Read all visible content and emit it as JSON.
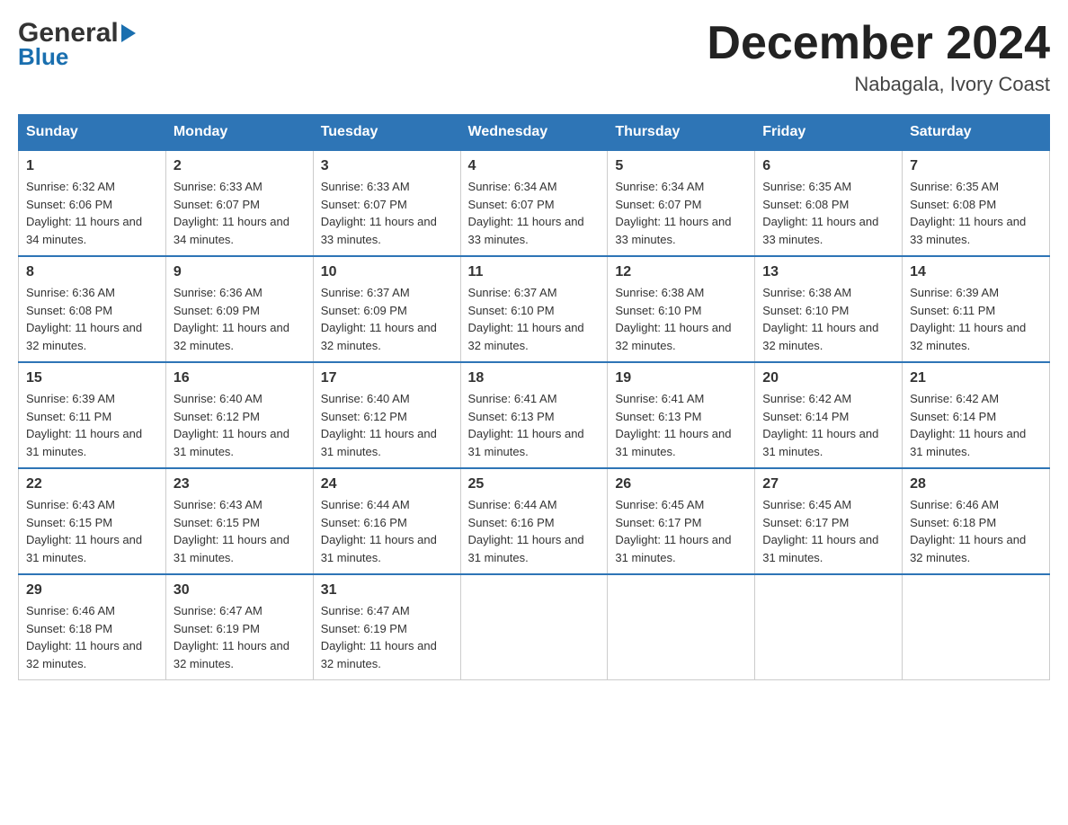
{
  "header": {
    "logo_general": "General",
    "logo_blue": "Blue",
    "month": "December 2024",
    "location": "Nabagala, Ivory Coast"
  },
  "days_of_week": [
    "Sunday",
    "Monday",
    "Tuesday",
    "Wednesday",
    "Thursday",
    "Friday",
    "Saturday"
  ],
  "weeks": [
    [
      {
        "num": "1",
        "sunrise": "6:32 AM",
        "sunset": "6:06 PM",
        "daylight": "11 hours and 34 minutes."
      },
      {
        "num": "2",
        "sunrise": "6:33 AM",
        "sunset": "6:07 PM",
        "daylight": "11 hours and 34 minutes."
      },
      {
        "num": "3",
        "sunrise": "6:33 AM",
        "sunset": "6:07 PM",
        "daylight": "11 hours and 33 minutes."
      },
      {
        "num": "4",
        "sunrise": "6:34 AM",
        "sunset": "6:07 PM",
        "daylight": "11 hours and 33 minutes."
      },
      {
        "num": "5",
        "sunrise": "6:34 AM",
        "sunset": "6:07 PM",
        "daylight": "11 hours and 33 minutes."
      },
      {
        "num": "6",
        "sunrise": "6:35 AM",
        "sunset": "6:08 PM",
        "daylight": "11 hours and 33 minutes."
      },
      {
        "num": "7",
        "sunrise": "6:35 AM",
        "sunset": "6:08 PM",
        "daylight": "11 hours and 33 minutes."
      }
    ],
    [
      {
        "num": "8",
        "sunrise": "6:36 AM",
        "sunset": "6:08 PM",
        "daylight": "11 hours and 32 minutes."
      },
      {
        "num": "9",
        "sunrise": "6:36 AM",
        "sunset": "6:09 PM",
        "daylight": "11 hours and 32 minutes."
      },
      {
        "num": "10",
        "sunrise": "6:37 AM",
        "sunset": "6:09 PM",
        "daylight": "11 hours and 32 minutes."
      },
      {
        "num": "11",
        "sunrise": "6:37 AM",
        "sunset": "6:10 PM",
        "daylight": "11 hours and 32 minutes."
      },
      {
        "num": "12",
        "sunrise": "6:38 AM",
        "sunset": "6:10 PM",
        "daylight": "11 hours and 32 minutes."
      },
      {
        "num": "13",
        "sunrise": "6:38 AM",
        "sunset": "6:10 PM",
        "daylight": "11 hours and 32 minutes."
      },
      {
        "num": "14",
        "sunrise": "6:39 AM",
        "sunset": "6:11 PM",
        "daylight": "11 hours and 32 minutes."
      }
    ],
    [
      {
        "num": "15",
        "sunrise": "6:39 AM",
        "sunset": "6:11 PM",
        "daylight": "11 hours and 31 minutes."
      },
      {
        "num": "16",
        "sunrise": "6:40 AM",
        "sunset": "6:12 PM",
        "daylight": "11 hours and 31 minutes."
      },
      {
        "num": "17",
        "sunrise": "6:40 AM",
        "sunset": "6:12 PM",
        "daylight": "11 hours and 31 minutes."
      },
      {
        "num": "18",
        "sunrise": "6:41 AM",
        "sunset": "6:13 PM",
        "daylight": "11 hours and 31 minutes."
      },
      {
        "num": "19",
        "sunrise": "6:41 AM",
        "sunset": "6:13 PM",
        "daylight": "11 hours and 31 minutes."
      },
      {
        "num": "20",
        "sunrise": "6:42 AM",
        "sunset": "6:14 PM",
        "daylight": "11 hours and 31 minutes."
      },
      {
        "num": "21",
        "sunrise": "6:42 AM",
        "sunset": "6:14 PM",
        "daylight": "11 hours and 31 minutes."
      }
    ],
    [
      {
        "num": "22",
        "sunrise": "6:43 AM",
        "sunset": "6:15 PM",
        "daylight": "11 hours and 31 minutes."
      },
      {
        "num": "23",
        "sunrise": "6:43 AM",
        "sunset": "6:15 PM",
        "daylight": "11 hours and 31 minutes."
      },
      {
        "num": "24",
        "sunrise": "6:44 AM",
        "sunset": "6:16 PM",
        "daylight": "11 hours and 31 minutes."
      },
      {
        "num": "25",
        "sunrise": "6:44 AM",
        "sunset": "6:16 PM",
        "daylight": "11 hours and 31 minutes."
      },
      {
        "num": "26",
        "sunrise": "6:45 AM",
        "sunset": "6:17 PM",
        "daylight": "11 hours and 31 minutes."
      },
      {
        "num": "27",
        "sunrise": "6:45 AM",
        "sunset": "6:17 PM",
        "daylight": "11 hours and 31 minutes."
      },
      {
        "num": "28",
        "sunrise": "6:46 AM",
        "sunset": "6:18 PM",
        "daylight": "11 hours and 32 minutes."
      }
    ],
    [
      {
        "num": "29",
        "sunrise": "6:46 AM",
        "sunset": "6:18 PM",
        "daylight": "11 hours and 32 minutes."
      },
      {
        "num": "30",
        "sunrise": "6:47 AM",
        "sunset": "6:19 PM",
        "daylight": "11 hours and 32 minutes."
      },
      {
        "num": "31",
        "sunrise": "6:47 AM",
        "sunset": "6:19 PM",
        "daylight": "11 hours and 32 minutes."
      },
      null,
      null,
      null,
      null
    ]
  ]
}
